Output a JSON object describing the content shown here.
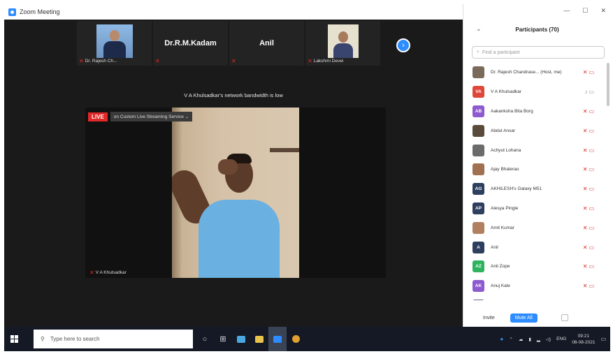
{
  "window": {
    "title": "Zoom Meeting",
    "controls": [
      "—",
      "☐",
      "✕"
    ]
  },
  "video_strip": {
    "tiles": [
      {
        "type": "photo",
        "label": "Dr. Rajesh Ch..."
      },
      {
        "type": "name",
        "name": "Dr.R.M.Kadam"
      },
      {
        "type": "name",
        "name": "Anil"
      },
      {
        "type": "photo",
        "label": "Lakshmi Devei"
      }
    ]
  },
  "network_notice": "V A Khulsadkar's network bandwidth is low",
  "main_video": {
    "live_badge": "LIVE",
    "service_label": "on Custom Live Streaming Service",
    "participant_name": "V A Khulsadkar"
  },
  "participants_panel": {
    "title": "Participants (70)",
    "search_placeholder": "Find a participant",
    "participants": [
      {
        "name": "Dr. Rajesh Chandrase... (Host, me)",
        "avatar_text": "",
        "avatar_color": "#7a6a5a",
        "muted": true
      },
      {
        "name": "V A Khulsadkar",
        "avatar_text": "VA",
        "avatar_color": "#e0473b",
        "muted": false
      },
      {
        "name": "Aakanksha Bita Borg",
        "avatar_text": "AB",
        "avatar_color": "#8e5bcf",
        "muted": true
      },
      {
        "name": "Abdul Ansar",
        "avatar_text": "",
        "avatar_color": "#5a4a3a",
        "muted": true
      },
      {
        "name": "Achyut Lohana",
        "avatar_text": "",
        "avatar_color": "#6b6b6b",
        "muted": true
      },
      {
        "name": "Ajay Bhalerao",
        "avatar_text": "",
        "avatar_color": "#a07050",
        "muted": true
      },
      {
        "name": "AKHILESH's Galaxy M51",
        "avatar_text": "AG",
        "avatar_color": "#2d3e5e",
        "muted": true
      },
      {
        "name": "Alesya Pingle",
        "avatar_text": "AP",
        "avatar_color": "#2d3e5e",
        "muted": true
      },
      {
        "name": "Amit Kumar",
        "avatar_text": "",
        "avatar_color": "#b08060",
        "muted": true
      },
      {
        "name": "Anil",
        "avatar_text": "A",
        "avatar_color": "#2d3e5e",
        "muted": true
      },
      {
        "name": "Anil Zope",
        "avatar_text": "AZ",
        "avatar_color": "#2fb35f",
        "muted": true
      },
      {
        "name": "Anuj Kale",
        "avatar_text": "AK",
        "avatar_color": "#8e5bcf",
        "muted": true
      },
      {
        "name": "",
        "avatar_text": "",
        "avatar_color": "#6a6a8a",
        "muted": true
      }
    ],
    "footer": {
      "invite_label": "Invite",
      "mute_all_label": "Mute All"
    }
  },
  "taskbar": {
    "search_placeholder": "Type here to search",
    "language": "ENG",
    "time": "09:21",
    "date": "08-08-2021"
  }
}
